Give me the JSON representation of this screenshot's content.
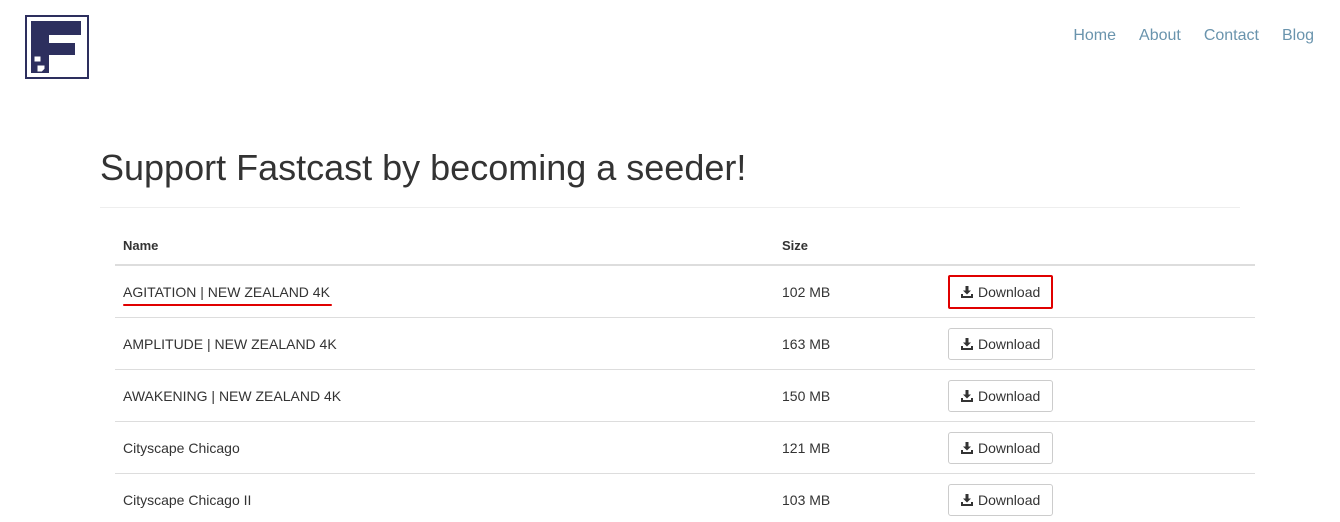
{
  "nav": {
    "items": [
      {
        "label": "Home"
      },
      {
        "label": "About"
      },
      {
        "label": "Contact"
      },
      {
        "label": "Blog"
      }
    ]
  },
  "heading": "Support Fastcast by becoming a seeder!",
  "table": {
    "columns": {
      "name": "Name",
      "size": "Size"
    },
    "rows": [
      {
        "name": "AGITATION | NEW ZEALAND 4K",
        "size": "102 MB",
        "button": "Download",
        "highlighted": true
      },
      {
        "name": "AMPLITUDE | NEW ZEALAND 4K",
        "size": "163 MB",
        "button": "Download",
        "highlighted": false
      },
      {
        "name": "AWAKENING | NEW ZEALAND 4K",
        "size": "150 MB",
        "button": "Download",
        "highlighted": false
      },
      {
        "name": "Cityscape Chicago",
        "size": "121 MB",
        "button": "Download",
        "highlighted": false
      },
      {
        "name": "Cityscape Chicago II",
        "size": "103 MB",
        "button": "Download",
        "highlighted": false
      }
    ]
  },
  "icons": {
    "logo": "fastcast-logo-icon",
    "download": "download-icon"
  },
  "colors": {
    "nav_link": "#6a94ad",
    "logo_navy": "#2d2f5e",
    "highlight": "#e00000"
  }
}
